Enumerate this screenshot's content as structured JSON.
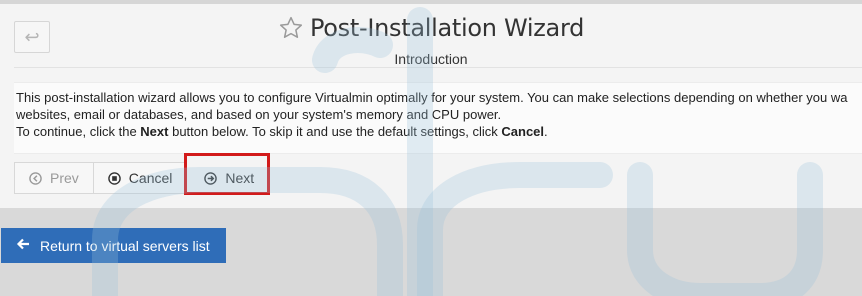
{
  "header": {
    "back_icon_glyph": "↩",
    "title": "Post-Installation Wizard",
    "subtitle": "Introduction"
  },
  "description": {
    "line1": "This post-installation wizard allows you to configure Virtualmin optimally for your system. You can make selections depending on whether you wa",
    "line2": "websites, email or databases, and based on your system's memory and CPU power.",
    "line3_pre": "To continue, click the ",
    "line3_next": "Next",
    "line3_mid": " button below. To skip it and use the default settings, click ",
    "line3_cancel": "Cancel",
    "line3_post": "."
  },
  "buttons": {
    "prev": "Prev",
    "cancel": "Cancel",
    "next": "Next"
  },
  "return_button": {
    "label": "Return to virtual servers list"
  },
  "colors": {
    "accent": "#2f6db8",
    "highlight": "#d21a1a"
  }
}
